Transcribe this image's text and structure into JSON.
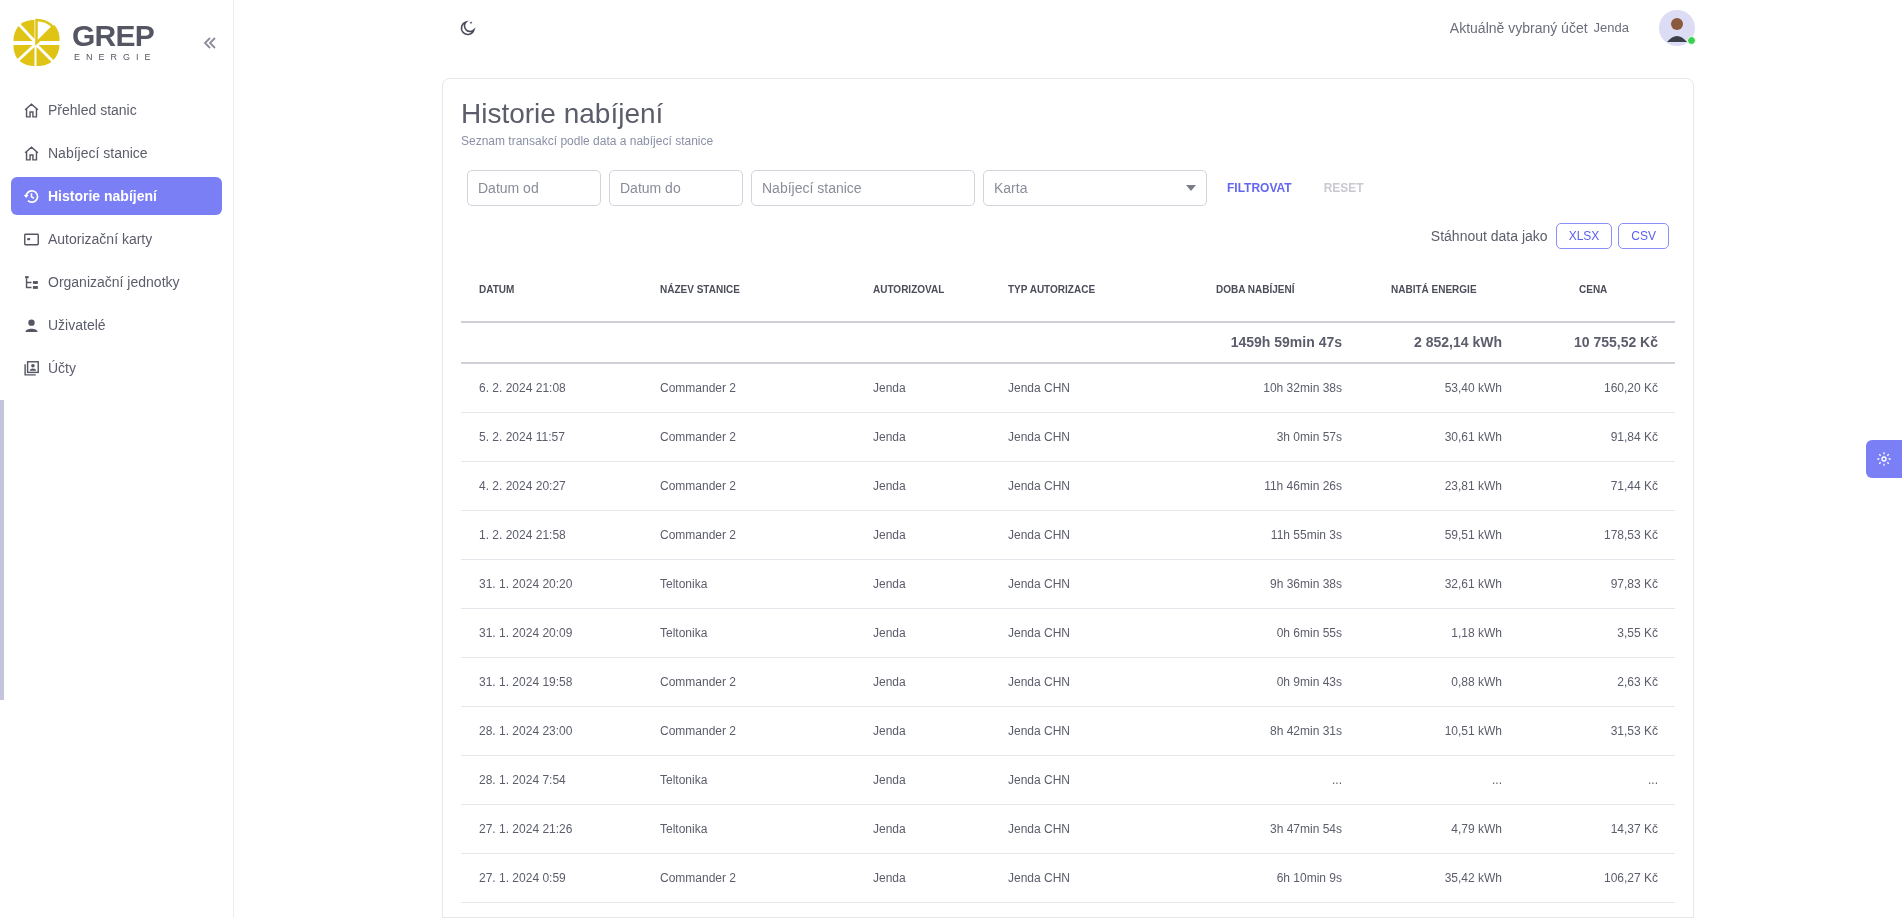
{
  "logo": {
    "name": "GREP",
    "tagline": "ENERGIE"
  },
  "sidebar": {
    "items": [
      {
        "label": "Přehled stanic",
        "selected": false
      },
      {
        "label": "Nabíjecí stanice",
        "selected": false
      },
      {
        "label": "Historie nabíjení",
        "selected": true
      },
      {
        "label": "Autorizační karty",
        "selected": false
      },
      {
        "label": "Organizační jednotky",
        "selected": false
      },
      {
        "label": "Uživatelé",
        "selected": false
      },
      {
        "label": "Účty",
        "selected": false
      }
    ]
  },
  "header": {
    "account_label": "Aktuálně vybraný účet",
    "account_name": "Jenda",
    "online": true
  },
  "page": {
    "title": "Historie nabíjení",
    "subtitle": "Seznam transakcí podle data a nabíjecí stanice"
  },
  "filters": {
    "fields": [
      {
        "placeholder": "Datum od",
        "kind": "text"
      },
      {
        "placeholder": "Datum do",
        "kind": "text"
      },
      {
        "placeholder": "Nabíjecí stanice",
        "kind": "text"
      },
      {
        "placeholder": "Karta",
        "kind": "select"
      }
    ],
    "buttons": [
      {
        "label": "FILTROVAT",
        "disabled": false
      },
      {
        "label": "RESET",
        "disabled": true
      }
    ]
  },
  "download": {
    "label": "Stáhnout data jako",
    "buttons": [
      "XLSX",
      "CSV"
    ]
  },
  "table": {
    "columns": [
      "DATUM",
      "NÁZEV STANICE",
      "AUTORIZOVAL",
      "TYP AUTORIZACE",
      "DOBA NABÍJENÍ",
      "NABITÁ ENERGIE",
      "CENA"
    ],
    "totals": {
      "duration": "1459h 59min 47s",
      "energy": "2 852,14 kWh",
      "price": "10 755,52 Kč"
    },
    "rows": [
      [
        "6. 2. 2024 21:08",
        "Commander 2",
        "Jenda",
        "Jenda CHN",
        "10h 32min 38s",
        "53,40 kWh",
        "160,20 Kč"
      ],
      [
        "5. 2. 2024 11:57",
        "Commander 2",
        "Jenda",
        "Jenda CHN",
        "3h 0min 57s",
        "30,61 kWh",
        "91,84 Kč"
      ],
      [
        "4. 2. 2024 20:27",
        "Commander 2",
        "Jenda",
        "Jenda CHN",
        "11h 46min 26s",
        "23,81 kWh",
        "71,44 Kč"
      ],
      [
        "1. 2. 2024 21:58",
        "Commander 2",
        "Jenda",
        "Jenda CHN",
        "11h 55min 3s",
        "59,51 kWh",
        "178,53 Kč"
      ],
      [
        "31. 1. 2024 20:20",
        "Teltonika",
        "Jenda",
        "Jenda CHN",
        "9h 36min 38s",
        "32,61 kWh",
        "97,83 Kč"
      ],
      [
        "31. 1. 2024 20:09",
        "Teltonika",
        "Jenda",
        "Jenda CHN",
        "0h 6min 55s",
        "1,18 kWh",
        "3,55 Kč"
      ],
      [
        "31. 1. 2024 19:58",
        "Commander 2",
        "Jenda",
        "Jenda CHN",
        "0h 9min 43s",
        "0,88 kWh",
        "2,63 Kč"
      ],
      [
        "28. 1. 2024 23:00",
        "Commander 2",
        "Jenda",
        "Jenda CHN",
        "8h 42min 31s",
        "10,51 kWh",
        "31,53 Kč"
      ],
      [
        "28. 1. 2024 7:54",
        "Teltonika",
        "Jenda",
        "Jenda CHN",
        "...",
        "...",
        "..."
      ],
      [
        "27. 1. 2024 21:26",
        "Teltonika",
        "Jenda",
        "Jenda CHN",
        "3h 47min 54s",
        "4,79 kWh",
        "14,37 Kč"
      ],
      [
        "27. 1. 2024 0:59",
        "Commander 2",
        "Jenda",
        "Jenda CHN",
        "6h 10min 9s",
        "35,42 kWh",
        "106,27 Kč"
      ]
    ]
  }
}
